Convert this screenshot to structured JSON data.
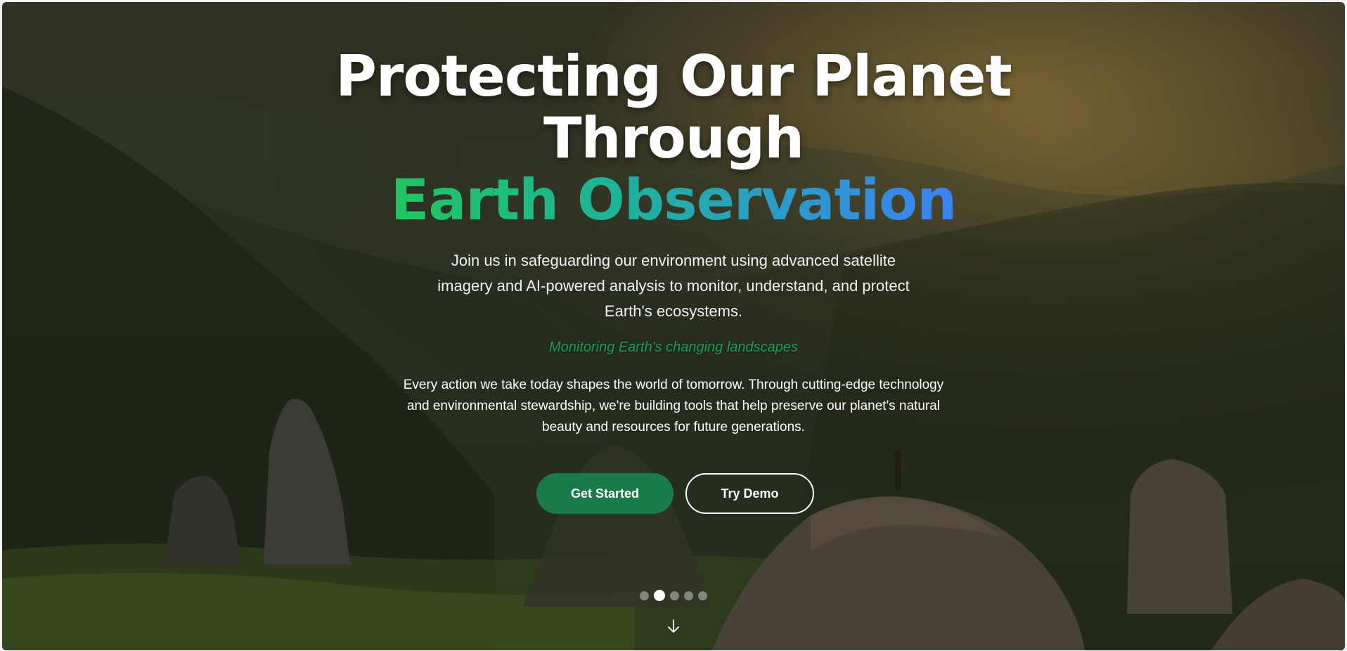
{
  "hero": {
    "headline_line1": "Protecting Our Planet",
    "headline_line2": "Through",
    "headline_highlight": "Earth Observation",
    "lead": "Join us in safeguarding our environment using advanced satellite imagery and AI-powered analysis to monitor, understand, and protect Earth's ecosystems.",
    "tagline": "Monitoring Earth's changing landscapes",
    "body": "Every action we take today shapes the world of tomorrow. Through cutting-edge technology and environmental stewardship, we're building tools that help preserve our planet's natural beauty and resources for future generations.",
    "background_icon": "mountain-landscape-image"
  },
  "actions": {
    "primary_label": "Get Started",
    "secondary_label": "Try Demo"
  },
  "carousel": {
    "slide_count": 5,
    "active_index": 1
  },
  "scroll_icon": "arrow-down-icon",
  "colors": {
    "primary_green": "#1a7a4a",
    "gradient_start": "#22c55e",
    "gradient_end": "#3b82f6",
    "tagline_green": "#1f9d55"
  }
}
